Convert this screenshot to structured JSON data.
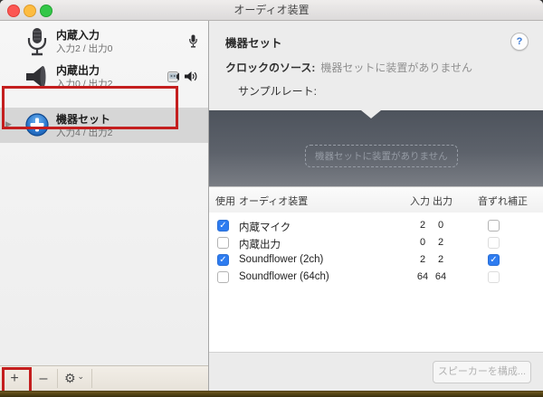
{
  "window": {
    "title": "オーディオ装置"
  },
  "sidebar": {
    "devices": [
      {
        "name": "内蔵入力",
        "detail": "入力2 / 出力0",
        "icon": "microphone-icon",
        "badge": "default-input-mic"
      },
      {
        "name": "内蔵出力",
        "detail": "入力0 / 出力2",
        "icon": "speaker-icon",
        "badges": [
          "sound-effects",
          "default-output-speaker"
        ]
      },
      {
        "name": "機器セット",
        "detail": "入力4 / 出力2",
        "icon": "aggregate-plus-icon",
        "selected": true,
        "disclosure": "▶"
      }
    ],
    "toolbar": {
      "add_label": "+",
      "remove_label": "–",
      "gear_label": "⚙",
      "chevron_label": "⌄"
    }
  },
  "panel": {
    "title": "機器セット",
    "help_label": "?",
    "clock_source_label": "クロックのソース:",
    "clock_source_value": "機器セットに装置がありません",
    "sample_rate_label": "サンプルレート:",
    "empty_message": "機器セットに装置がありません",
    "table": {
      "headers": [
        "使用",
        "オーディオ装置",
        "入力",
        "出力",
        "音ずれ補正"
      ],
      "rows": [
        {
          "use": true,
          "device": "内蔵マイク",
          "in": "2",
          "out": "0",
          "drift": false
        },
        {
          "use": false,
          "device": "内蔵出力",
          "in": "0",
          "out": "2",
          "drift": false
        },
        {
          "use": true,
          "device": "Soundflower (2ch)",
          "in": "2",
          "out": "2",
          "drift": true
        },
        {
          "use": false,
          "device": "Soundflower (64ch)",
          "in": "64",
          "out": "64",
          "drift": false
        }
      ]
    },
    "footer": {
      "configure_speakers_label": "スピーカーを構成..."
    }
  },
  "colors": {
    "accent_blue": "#2e7cf0",
    "annotation_red": "#c41e1e",
    "dropzone_gray": "#565c65"
  }
}
